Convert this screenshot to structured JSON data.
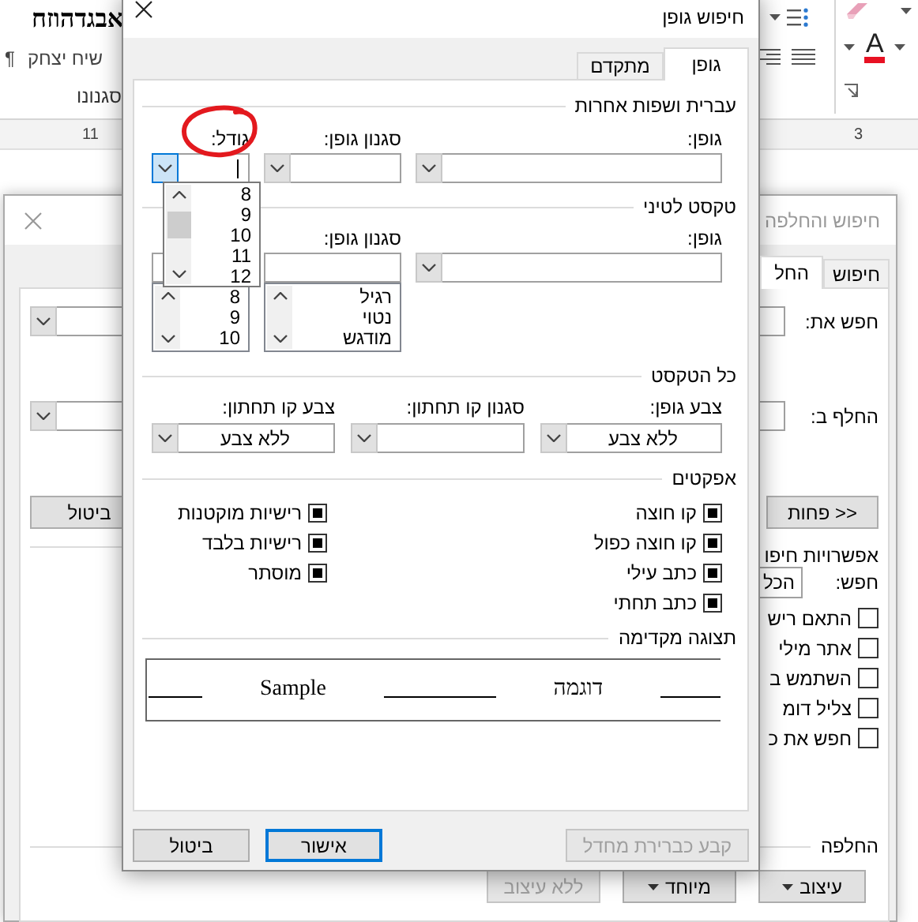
{
  "word": {
    "heading_sample": "אבגדהוזח",
    "style_sample": "שיח יצחק",
    "paragraph_mark": "¶",
    "styles_label": "סגנונו",
    "font_color_letter": "A",
    "ruler_numbers": [
      "3",
      "11"
    ]
  },
  "find_replace": {
    "title": "חיפוש והחלפה",
    "tabs": [
      {
        "label": "חיפוש",
        "selected": false
      },
      {
        "label": "החל",
        "selected": true
      }
    ],
    "find_label": "חפש את:",
    "replace_label": "החלף ב:",
    "less_button": "<< פחות",
    "cancel_button": "ביטול",
    "options_heading": "אפשרויות חיפו",
    "search_label": "חפש:",
    "search_value": "הכל",
    "options": [
      {
        "label": "התאם ריש",
        "checked": false
      },
      {
        "label": "אתר מילי",
        "checked": false
      },
      {
        "label": "השתמש ב",
        "checked": false
      },
      {
        "label": "צליל דומ",
        "checked": false
      },
      {
        "label": "חפש את כ",
        "checked": false
      }
    ],
    "replace_heading": "החלפה",
    "buttons": [
      {
        "label": "עיצוב",
        "kind": "menu",
        "disabled": false
      },
      {
        "label": "מיוחד",
        "kind": "menu",
        "disabled": false
      },
      {
        "label": "ללא עיצוב",
        "kind": "plain",
        "disabled": true
      }
    ]
  },
  "font_dialog": {
    "title": "חיפוש גופן",
    "tabs": [
      {
        "label": "גופן",
        "selected": true
      },
      {
        "label": "מתקדם",
        "selected": false
      }
    ],
    "hebrew": {
      "heading": "עברית ושפות אחרות",
      "font_label": "גופן:",
      "style_label": "סגנון גופן:",
      "size_label": "גודל:",
      "size_focused": true,
      "size_dropdown": [
        "8",
        "9",
        "10",
        "11",
        "12"
      ]
    },
    "latin": {
      "heading": "טקסט לטיני",
      "font_label": "גופן:",
      "style_label": "סגנון גופן:",
      "size_list": [
        "8",
        "9",
        "10"
      ],
      "style_list": [
        "רגיל",
        "נטוי",
        "מודגש"
      ]
    },
    "all_text": {
      "heading": "כל הטקסט",
      "font_color_label": "צבע גופן:",
      "font_color": "ללא צבע",
      "underline_style_label": "סגנון קו תחתון:",
      "underline_color_label": "צבע קו תחתון:",
      "underline_color": "ללא צבע"
    },
    "effects": {
      "heading": "אפקטים",
      "items": [
        {
          "label": "קו חוצה",
          "indeterminate": true
        },
        {
          "label": "רישיות מוקטנות",
          "indeterminate": true
        },
        {
          "label": "קו חוצה כפול",
          "indeterminate": true
        },
        {
          "label": "רישיות בלבד",
          "indeterminate": true
        },
        {
          "label": "כתב עילי",
          "indeterminate": true
        },
        {
          "label": "מוסתר",
          "indeterminate": true
        },
        {
          "label": "כתב תחתי",
          "indeterminate": true
        }
      ]
    },
    "preview": {
      "heading": "תצוגה מקדימה",
      "hebrew_sample": "דוגמה",
      "latin_sample": "Sample"
    },
    "buttons": [
      {
        "label": "קבע כברירת מחדל",
        "disabled": true,
        "default": false
      },
      {
        "label": "אישור",
        "disabled": false,
        "default": true
      },
      {
        "label": "ביטול",
        "disabled": false,
        "default": false
      }
    ]
  }
}
